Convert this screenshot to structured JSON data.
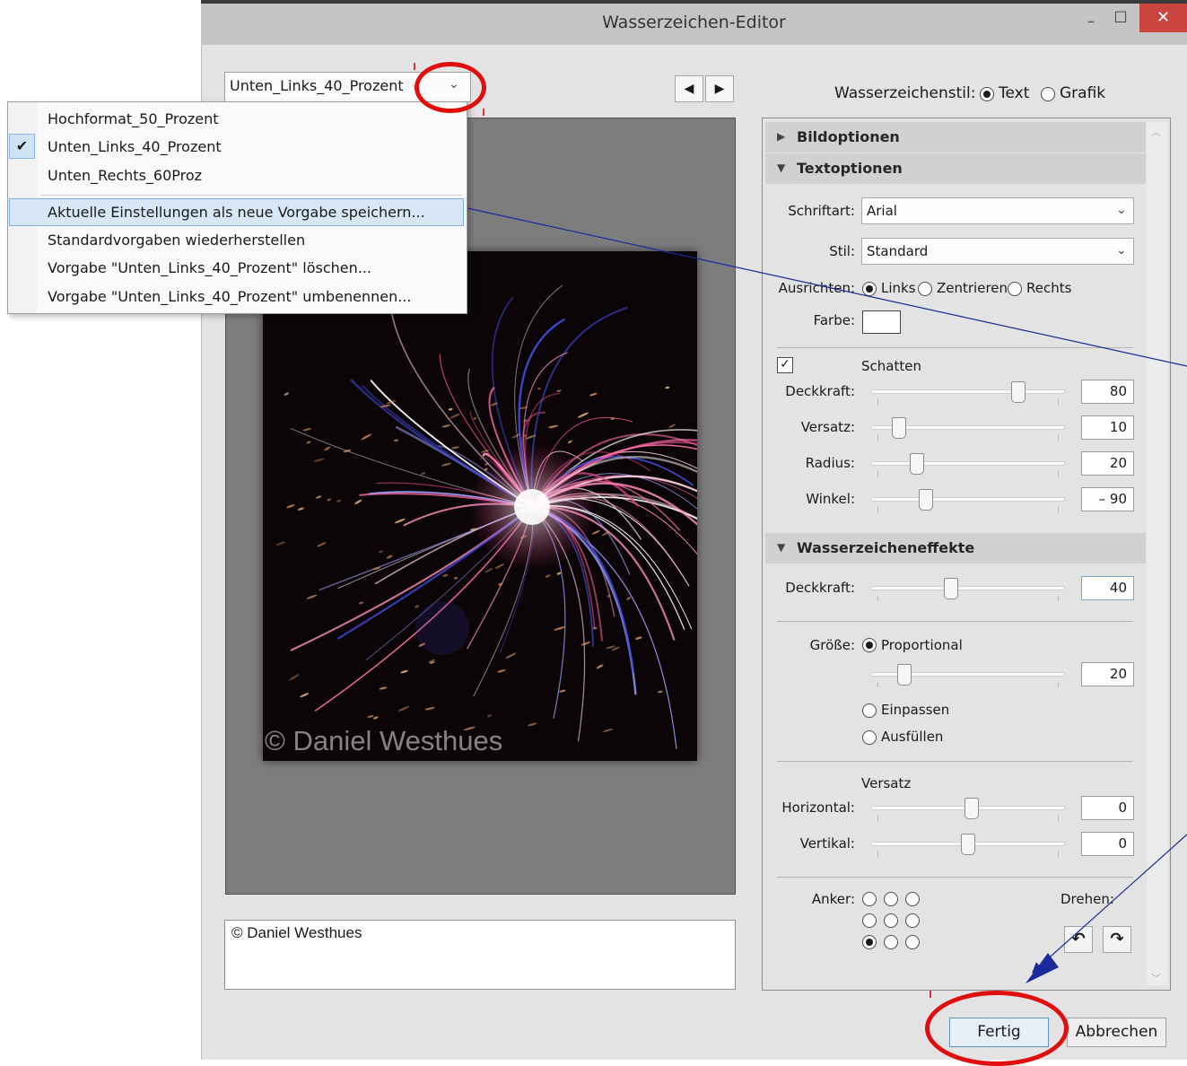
{
  "window": {
    "title": "Wasserzeichen-Editor",
    "minimize": "–",
    "maximize": "□",
    "close": "✕"
  },
  "preset": {
    "selected": "Unten_Links_40_Prozent",
    "chevron": "⌄"
  },
  "nav": {
    "prev": "◀",
    "next": "▶"
  },
  "preview": {
    "watermark_overlay": "© Daniel Westhues"
  },
  "watermark_text": "© Daniel Westhues",
  "style": {
    "label": "Wasserzeichenstil:",
    "text": "Text",
    "graphic": "Grafik",
    "selected": "Text"
  },
  "sections": {
    "image_options": "Bildoptionen",
    "text_options": "Textoptionen",
    "effects": "Wasserzeicheneffekte"
  },
  "text_options": {
    "font_label": "Schriftart:",
    "font_value": "Arial",
    "style_label": "Stil:",
    "style_value": "Standard",
    "align_label": "Ausrichten:",
    "align_left": "Links",
    "align_center": "Zentrieren",
    "align_right": "Rechts",
    "color_label": "Farbe:",
    "color_value": "#ffffff"
  },
  "shadow": {
    "label": "Schatten",
    "checked": true,
    "check_glyph": "✓",
    "opacity_label": "Deckkraft:",
    "opacity": "80",
    "opacity_level": 0.78,
    "offset_label": "Versatz:",
    "offset": "10",
    "offset_level": 0.12,
    "radius_label": "Radius:",
    "radius": "20",
    "radius_level": 0.22,
    "angle_label": "Winkel:",
    "angle": "– 90",
    "angle_level": 0.27
  },
  "effects": {
    "opacity_label": "Deckkraft:",
    "opacity": "40",
    "opacity_level": 0.41,
    "size_label": "Größe:",
    "proportional": "Proportional",
    "size": "20",
    "size_level": 0.15,
    "fit": "Einpassen",
    "fill": "Ausfüllen",
    "offset_title": "Versatz",
    "horizontal_label": "Horizontal:",
    "horizontal": "0",
    "horizontal_level": 0.52,
    "vertical_label": "Vertikal:",
    "vertical": "0",
    "vertical_level": 0.5,
    "anchor_label": "Anker:",
    "rotate_label": "Drehen:",
    "rotate_left": "↶",
    "rotate_right": "↷"
  },
  "buttons": {
    "done": "Fertig",
    "cancel": "Abbrechen"
  },
  "menu": {
    "check_glyph": "✔",
    "items": [
      "Hochformat_50_Prozent",
      "Unten_Links_40_Prozent",
      "Unten_Rechts_60Proz",
      "Aktuelle Einstellungen als neue Vorgabe speichern...",
      "Standardvorgaben wiederherstellen",
      "Vorgabe \"Unten_Links_40_Prozent\" löschen...",
      "Vorgabe \"Unten_Links_40_Prozent\" umbenennen..."
    ]
  },
  "colors": {
    "annotation_red": "#e10e0e",
    "arrow_blue": "#1a2a9a",
    "accent_blue": "#5d8fc9"
  }
}
